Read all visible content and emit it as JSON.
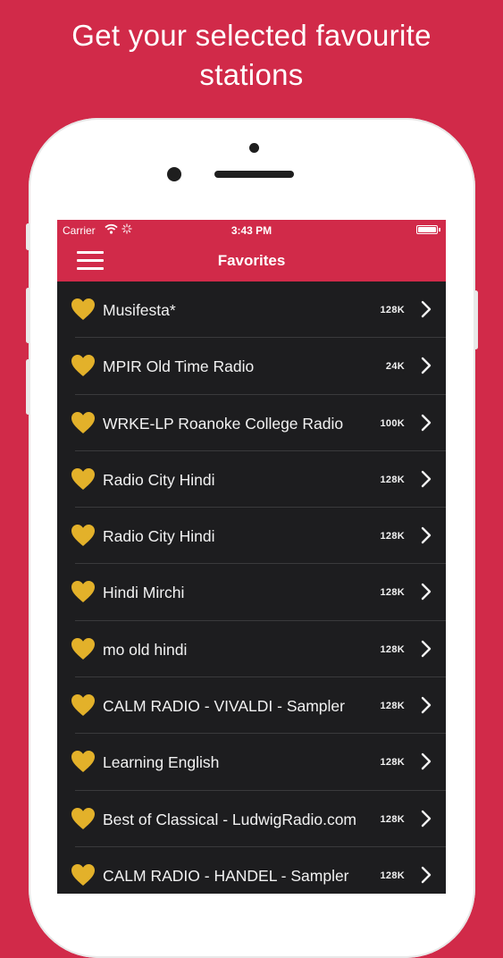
{
  "promo": {
    "headline_line1": "Get your selected favourite",
    "headline_line2": "stations"
  },
  "colors": {
    "brand": "#d12a49",
    "list_background": "#1d1d1f",
    "heart": "#e3b12a"
  },
  "status_bar": {
    "carrier": "Carrier",
    "time": "3:43 PM",
    "icons": [
      "wifi-icon",
      "activity-icon",
      "battery-icon"
    ]
  },
  "nav": {
    "title": "Favorites",
    "menu_icon": "hamburger-menu-icon"
  },
  "stations": [
    {
      "name": "Musifesta*",
      "bitrate": "128K"
    },
    {
      "name": "MPIR Old Time Radio",
      "bitrate": "24K"
    },
    {
      "name": "WRKE-LP Roanoke College Radio",
      "bitrate": "100K"
    },
    {
      "name": "Radio City Hindi",
      "bitrate": "128K"
    },
    {
      "name": "Radio City Hindi",
      "bitrate": "128K"
    },
    {
      "name": "Hindi Mirchi",
      "bitrate": "128K"
    },
    {
      "name": "mo old hindi",
      "bitrate": "128K"
    },
    {
      "name": "CALM RADIO - VIVALDI - Sampler",
      "bitrate": "128K"
    },
    {
      "name": "Learning English",
      "bitrate": "128K"
    },
    {
      "name": "Best of Classical - LudwigRadio.com",
      "bitrate": "128K"
    },
    {
      "name": "CALM RADIO - HANDEL - Sampler",
      "bitrate": "128K"
    }
  ]
}
